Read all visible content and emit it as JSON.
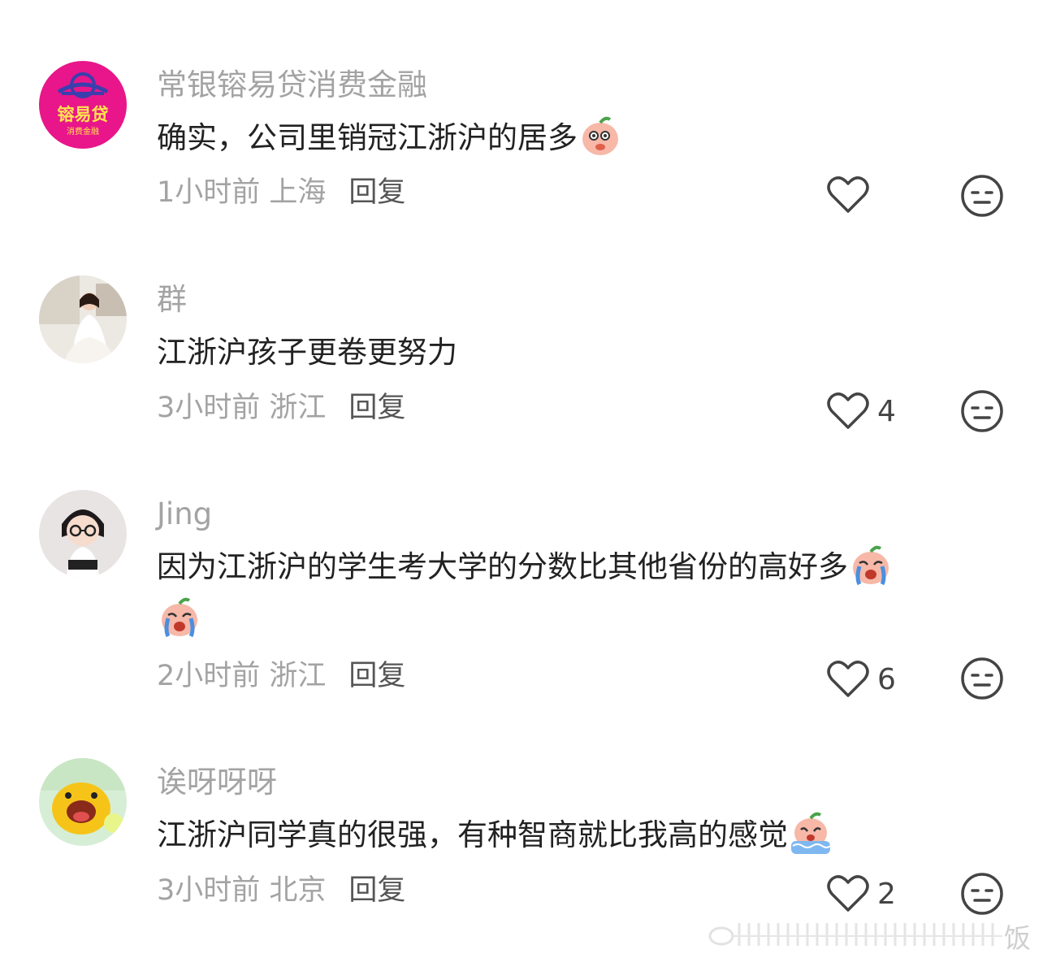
{
  "comments": [
    {
      "author": "常银镕易贷消费金融",
      "avatar": {
        "logo_text": "镕易贷",
        "logo_subtext": "消费金融",
        "bg_color": "#e8168a"
      },
      "text": "确实，公司里销冠江浙沪的居多",
      "emoji": [
        "shy-peach-emoji"
      ],
      "time_location": "1小时前 上海",
      "reply_label": "回复",
      "likes": ""
    },
    {
      "author": "群",
      "avatar": {
        "type": "photo-girl-white-dress"
      },
      "text": "江浙沪孩子更卷更努力",
      "emoji": [],
      "time_location": "3小时前 浙江",
      "reply_label": "回复",
      "likes": "4"
    },
    {
      "author": "Jing",
      "avatar": {
        "type": "cartoon-girl-glasses"
      },
      "text": "因为江浙沪的学生考大学的分数比其他省份的高好多",
      "emoji": [
        "crying-peach-emoji",
        "crying-peach-emoji"
      ],
      "time_location": "2小时前 浙江",
      "reply_label": "回复",
      "likes": "6"
    },
    {
      "author": "诶呀呀呀",
      "avatar": {
        "type": "yellow-cartoon-creature"
      },
      "text": "江浙沪同学真的很强，有种智商就比我高的感觉",
      "emoji": [
        "tears-flood-peach-emoji"
      ],
      "time_location": "3小时前 北京",
      "reply_label": "回复",
      "likes": "2"
    }
  ],
  "icons": {
    "like": "heart-outline-icon",
    "dislike": "neutral-face-icon"
  },
  "watermark": "饭"
}
